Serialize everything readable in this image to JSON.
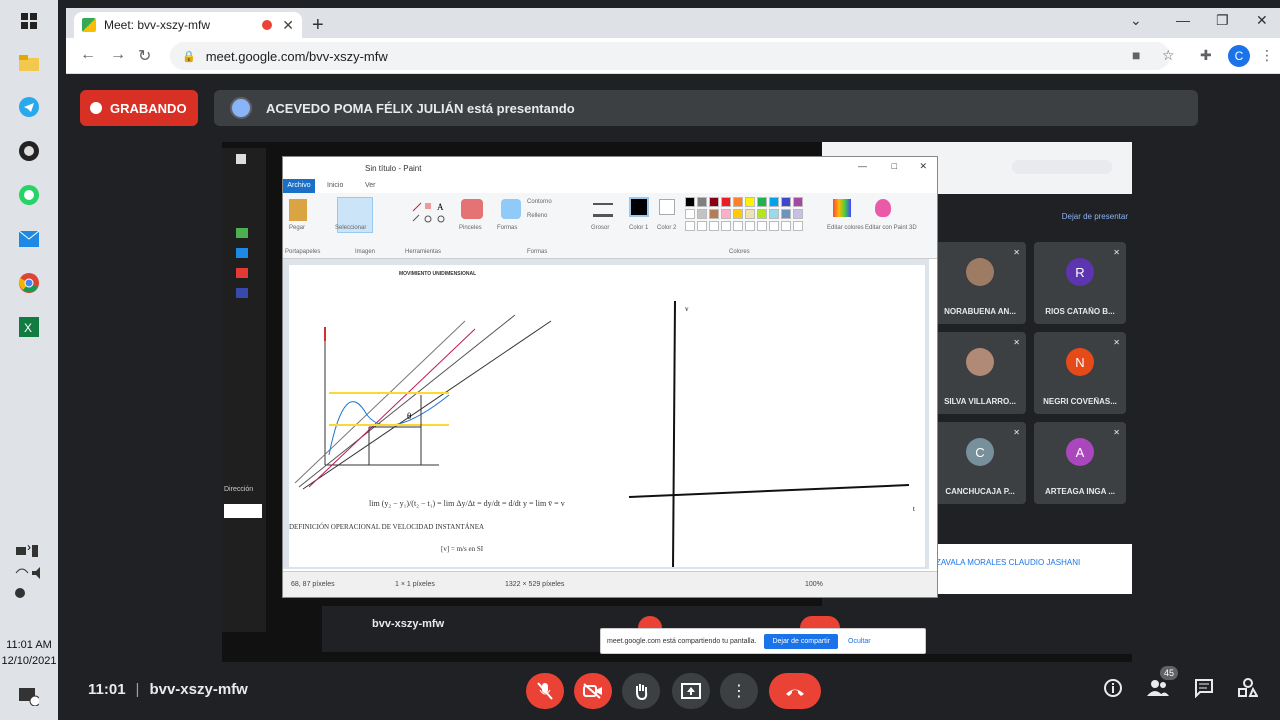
{
  "taskbar": {
    "time": "11:01 AM",
    "date": "12/10/2021",
    "notif_count": "5"
  },
  "browser": {
    "tab_title": "Meet: bvv-xszy-mfw",
    "url": "meet.google.com/bvv-xszy-mfw",
    "profile_initial": "C"
  },
  "meet": {
    "recording_label": "GRABANDO",
    "presenting_text": "ACEVEDO POMA FÉLIX JULIÁN está presentando",
    "time": "11:01",
    "meeting_code": "bvv-xszy-mfw",
    "participant_count": "45"
  },
  "shared_screen": {
    "remote_start_label": "Dirección",
    "remote_meeting_code": "bvv-xszy-mfw",
    "present_stop_label": "Dejar de presentar",
    "tiles": [
      {
        "name": "NORABUENA AN...",
        "initial": "",
        "color": "#9e7c64"
      },
      {
        "name": "RIOS CATAÑO B...",
        "initial": "R",
        "color": "#5e35b1"
      },
      {
        "name": "SILVA VILLARRO...",
        "initial": "",
        "color": "#b08a76"
      },
      {
        "name": "NEGRI COVEÑAS...",
        "initial": "N",
        "color": "#e64a19"
      },
      {
        "name": "CANCHUCAJA P...",
        "initial": "C",
        "color": "#78909c"
      },
      {
        "name": "ARTEAGA INGA ...",
        "initial": "A",
        "color": "#ab47bc"
      }
    ],
    "popup_name": "ZAVALA MORALES CLAUDIO JASHANI",
    "share_notice": "meet.google.com está compartiendo tu pantalla.",
    "share_stop": "Dejar de compartir",
    "share_hide": "Ocultar",
    "paint": {
      "title": "Sin título - Paint",
      "tabs": [
        "Archivo",
        "Inicio",
        "Ver"
      ],
      "groups": [
        "Portapapeles",
        "Imagen",
        "Herramientas",
        "Formas",
        "Colores"
      ],
      "buttons": [
        "Pegar",
        "Seleccionar",
        "Pinceles",
        "Formas",
        "Grosor",
        "Color 1",
        "Color 2",
        "Editar colores",
        "Editar con Paint 3D"
      ],
      "outline_label": "Contorno",
      "fill_label": "Relleno",
      "canvas_heading": "MOVIMIENTO UNIDIMENSIONAL",
      "formula_def": "DEFINICIÓN OPERACIONAL DE VELOCIDAD INSTANTÁNEA",
      "status_pos": "68, 87 píxeles",
      "status_sel": "1 × 1 píxeles",
      "status_size": "1322 × 529 píxeles",
      "zoom": "100%"
    },
    "palette": [
      "#000000",
      "#7f7f7f",
      "#880015",
      "#ed1c24",
      "#ff7f27",
      "#fff200",
      "#22b14c",
      "#00a2e8",
      "#3f48cc",
      "#a349a4",
      "#ffffff",
      "#c3c3c3",
      "#b97a57",
      "#ffaec9",
      "#ffc90e",
      "#efe4b0",
      "#b5e61d",
      "#99d9ea",
      "#7092be",
      "#c8bfe7"
    ]
  }
}
